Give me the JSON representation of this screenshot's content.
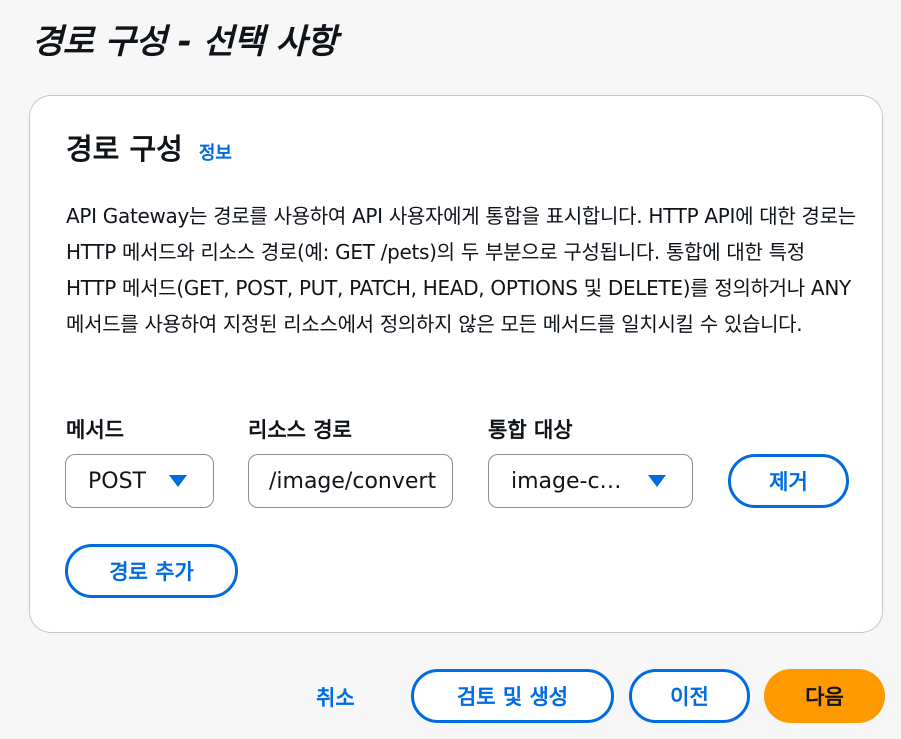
{
  "page": {
    "title": "경로 구성 - 선택 사항"
  },
  "card": {
    "title": "경로 구성",
    "info_link": "정보",
    "description": "API Gateway는 경로를 사용하여 API 사용자에게 통합을 표시합니다. HTTP API에 대한 경로는 HTTP 메서드와 리소스 경로(예: GET /pets)의 두 부분으로 구성됩니다. 통합에 대한 특정 HTTP 메서드(GET, POST, PUT, PATCH, HEAD, OPTIONS 및 DELETE)를 정의하거나 ANY 메서드를 사용하여 지정된 리소스에서 정의하지 않은 모든 메서드를 일치시킬 수 있습니다."
  },
  "route": {
    "method_label": "메서드",
    "method_value": "POST",
    "resource_path_label": "리소스 경로",
    "resource_path_value": "/image/convert",
    "integration_label": "통합 대상",
    "integration_value": "image-c…",
    "remove_label": "제거"
  },
  "add_route_label": "경로 추가",
  "footer": {
    "cancel_label": "취소",
    "review_create_label": "검토 및 생성",
    "previous_label": "이전",
    "next_label": "다음"
  },
  "colors": {
    "accent": "#006ce0",
    "primary_button": "#ff9900",
    "background": "#f7f7f7"
  }
}
